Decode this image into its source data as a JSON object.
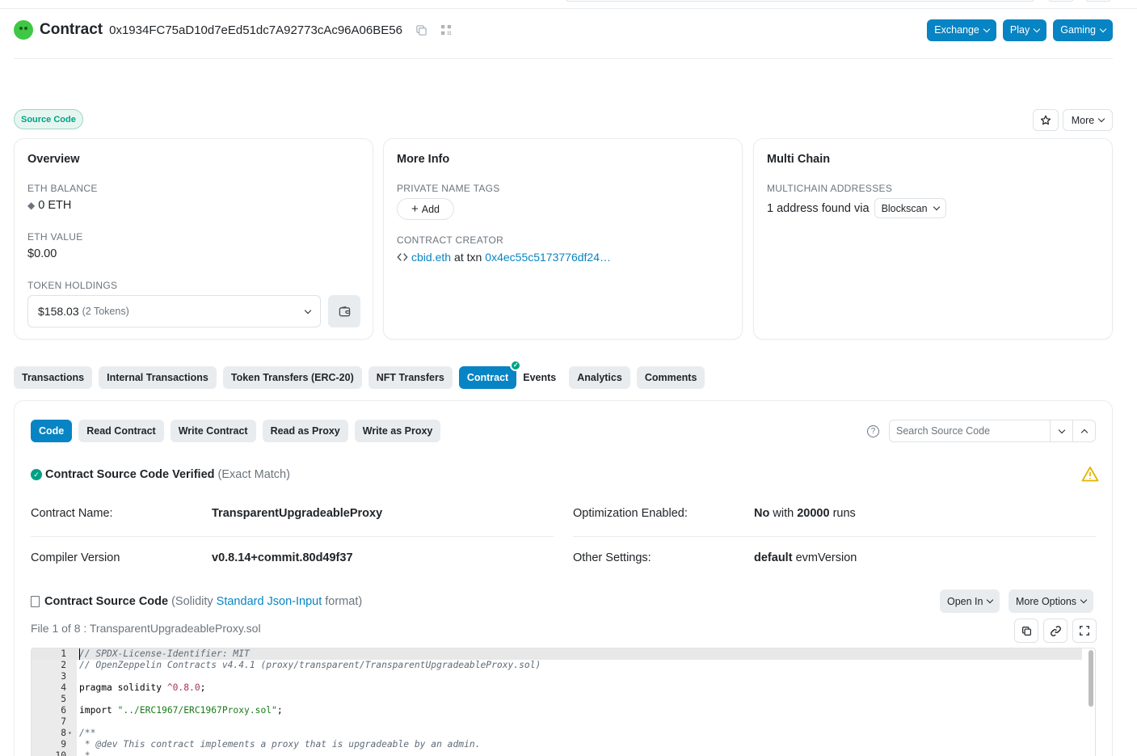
{
  "header": {
    "title": "Contract",
    "address": "0x1934FC75aD10d7eEd51dc7A92773cAc96A06BE56",
    "buttons": [
      "Exchange",
      "Play",
      "Gaming"
    ]
  },
  "badge": "Source Code",
  "more_label": "More",
  "overview": {
    "title": "Overview",
    "eth_balance_label": "ETH BALANCE",
    "eth_balance": "0 ETH",
    "eth_value_label": "ETH VALUE",
    "eth_value": "$0.00",
    "token_label": "TOKEN HOLDINGS",
    "token_value": "$158.03",
    "token_count": "(2 Tokens)"
  },
  "more_info": {
    "title": "More Info",
    "tags_label": "PRIVATE NAME TAGS",
    "add_label": "Add",
    "creator_label": "CONTRACT CREATOR",
    "creator_name": "cbid.eth",
    "at_txn": "at txn",
    "txn_hash": "0x4ec55c5173776df24…"
  },
  "multi_chain": {
    "title": "Multi Chain",
    "label": "MULTICHAIN ADDRESSES",
    "text": "1 address found via",
    "source": "Blockscan"
  },
  "tabs": [
    "Transactions",
    "Internal Transactions",
    "Token Transfers (ERC-20)",
    "NFT Transfers",
    "Contract",
    "Events",
    "Analytics",
    "Comments"
  ],
  "subtabs": [
    "Code",
    "Read Contract",
    "Write Contract",
    "Read as Proxy",
    "Write as Proxy"
  ],
  "search_placeholder": "Search Source Code",
  "verified": {
    "text": "Contract Source Code Verified",
    "match": "(Exact Match)"
  },
  "details": {
    "name_label": "Contract Name:",
    "name_value": "TransparentUpgradeableProxy",
    "opt_label": "Optimization Enabled:",
    "opt_value": "No",
    "opt_with": "with",
    "opt_runs": "20000",
    "opt_runs_suffix": "runs",
    "compiler_label": "Compiler Version",
    "compiler_value": "v0.8.14+commit.80d49f37",
    "other_label": "Other Settings:",
    "other_value": "default",
    "other_suffix": "evmVersion"
  },
  "source": {
    "title": "Contract Source Code",
    "paren_open": "(Solidity",
    "format_link": "Standard Json-Input",
    "paren_close": "format)",
    "open_in": "Open In",
    "more_options": "More Options",
    "file_info": "File 1 of 8 : TransparentUpgradeableProxy.sol"
  },
  "code_lines": [
    {
      "n": "1",
      "text": "// SPDX-License-Identifier: MIT",
      "kind": "comment"
    },
    {
      "n": "2",
      "text": "// OpenZeppelin Contracts v4.4.1 (proxy/transparent/TransparentUpgradeableProxy.sol)",
      "kind": "comment"
    },
    {
      "n": "3",
      "text": "",
      "kind": "plain"
    },
    {
      "n": "4",
      "text": "pragma solidity ^0.8.0;",
      "kind": "pragma"
    },
    {
      "n": "5",
      "text": "",
      "kind": "plain"
    },
    {
      "n": "6",
      "text": "import \"../ERC1967/ERC1967Proxy.sol\";",
      "kind": "import"
    },
    {
      "n": "7",
      "text": "",
      "kind": "plain"
    },
    {
      "n": "8",
      "text": "/**",
      "kind": "comment"
    },
    {
      "n": "9",
      "text": " * @dev This contract implements a proxy that is upgradeable by an admin.",
      "kind": "comment"
    },
    {
      "n": "10",
      "text": " *",
      "kind": "comment"
    }
  ],
  "colors": {
    "primary": "#0784c3",
    "success": "#00a186",
    "warning": "#e5b300",
    "tab_bg": "#e9ecef"
  }
}
